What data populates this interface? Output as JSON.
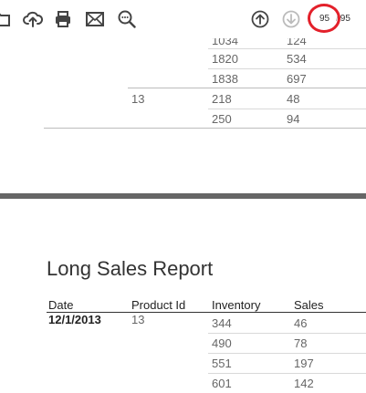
{
  "toolbar": {
    "icons": [
      "open-icon",
      "upload-icon",
      "print-icon",
      "email-icon",
      "zoom-icon",
      "previous-page-icon",
      "next-page-icon"
    ],
    "current_page": "95",
    "total_pages": "95",
    "highlight_color": "#e3202a"
  },
  "page1": {
    "rows": [
      {
        "group": "",
        "inventory": "1034",
        "sales": "124"
      },
      {
        "group": "",
        "inventory": "1820",
        "sales": "534"
      },
      {
        "group": "",
        "inventory": "1838",
        "sales": "697"
      },
      {
        "group": "13",
        "inventory": "218",
        "sales": "48"
      },
      {
        "group": "",
        "inventory": "250",
        "sales": "94"
      }
    ]
  },
  "page2": {
    "title": "Long Sales Report",
    "headers": {
      "date": "Date",
      "product_id": "Product Id",
      "inventory": "Inventory",
      "sales": "Sales"
    },
    "date_value": "12/1/2013",
    "product_id_value": "13",
    "rows": [
      {
        "inventory": "344",
        "sales": "46"
      },
      {
        "inventory": "490",
        "sales": "78"
      },
      {
        "inventory": "551",
        "sales": "197"
      },
      {
        "inventory": "601",
        "sales": "142"
      }
    ]
  }
}
